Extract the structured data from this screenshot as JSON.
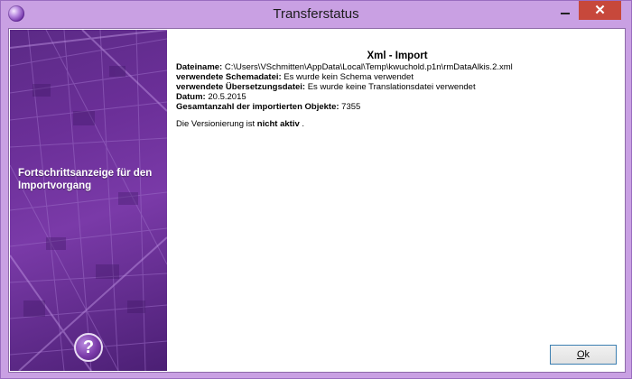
{
  "window": {
    "title": "Transferstatus",
    "close_glyph": "✕"
  },
  "banner": {
    "text": "Fortschrittsanzeige für den Importvorgang",
    "help_glyph": "?"
  },
  "content": {
    "heading": "Xml - Import",
    "fields": [
      {
        "label": "Dateiname:",
        "value": " C:\\Users\\VSchmitten\\AppData\\Local\\Temp\\kwuchold.p1n\\rmDataAlkis.2.xml"
      },
      {
        "label": "verwendete Schemadatei:",
        "value": " Es wurde kein Schema verwendet"
      },
      {
        "label": "verwendete Übersetzungsdatei:",
        "value": " Es wurde keine Translationsdatei verwendet"
      },
      {
        "label": "Datum:",
        "value": " 20.5.2015"
      },
      {
        "label": "Gesamtanzahl der importierten Objekte:",
        "value": " 7355"
      }
    ],
    "versioning_prefix": "Die Versionierung ist ",
    "versioning_state": "nicht aktiv",
    "versioning_suffix": " ."
  },
  "buttons": {
    "ok_accel": "O",
    "ok_rest": "k"
  },
  "colors": {
    "frame": "#c9a0e3",
    "close": "#c7483b",
    "banner": "#6b2f98"
  }
}
